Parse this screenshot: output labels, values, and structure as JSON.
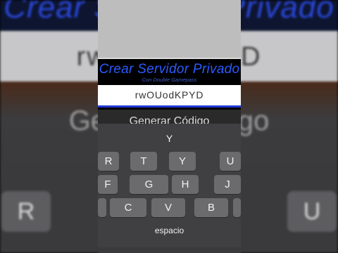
{
  "background": {
    "title": "Crear Servidor Privado",
    "subtitle": "Con Double Gamepass",
    "input_value": "rwOUodKPYD",
    "generate_label": "Generar Código",
    "keys": [
      "R",
      "U"
    ]
  },
  "app": {
    "title": "Crear Servidor Privado",
    "subtitle": "Con Double Gamepass",
    "code_value": "rwOUodKPYD",
    "generate_label": "Generar Código"
  },
  "keyboard": {
    "suggestion": "Y",
    "row1": [
      "R",
      "T",
      "Y",
      "U"
    ],
    "row2": [
      "F",
      "G",
      "H",
      "J"
    ],
    "row3": [
      "C",
      "V",
      "B"
    ],
    "space_label": "espacio"
  },
  "colors": {
    "accent_blue": "#2b5bff",
    "keyboard_bg": "#404043",
    "key_bg": "#6b6b6e"
  }
}
